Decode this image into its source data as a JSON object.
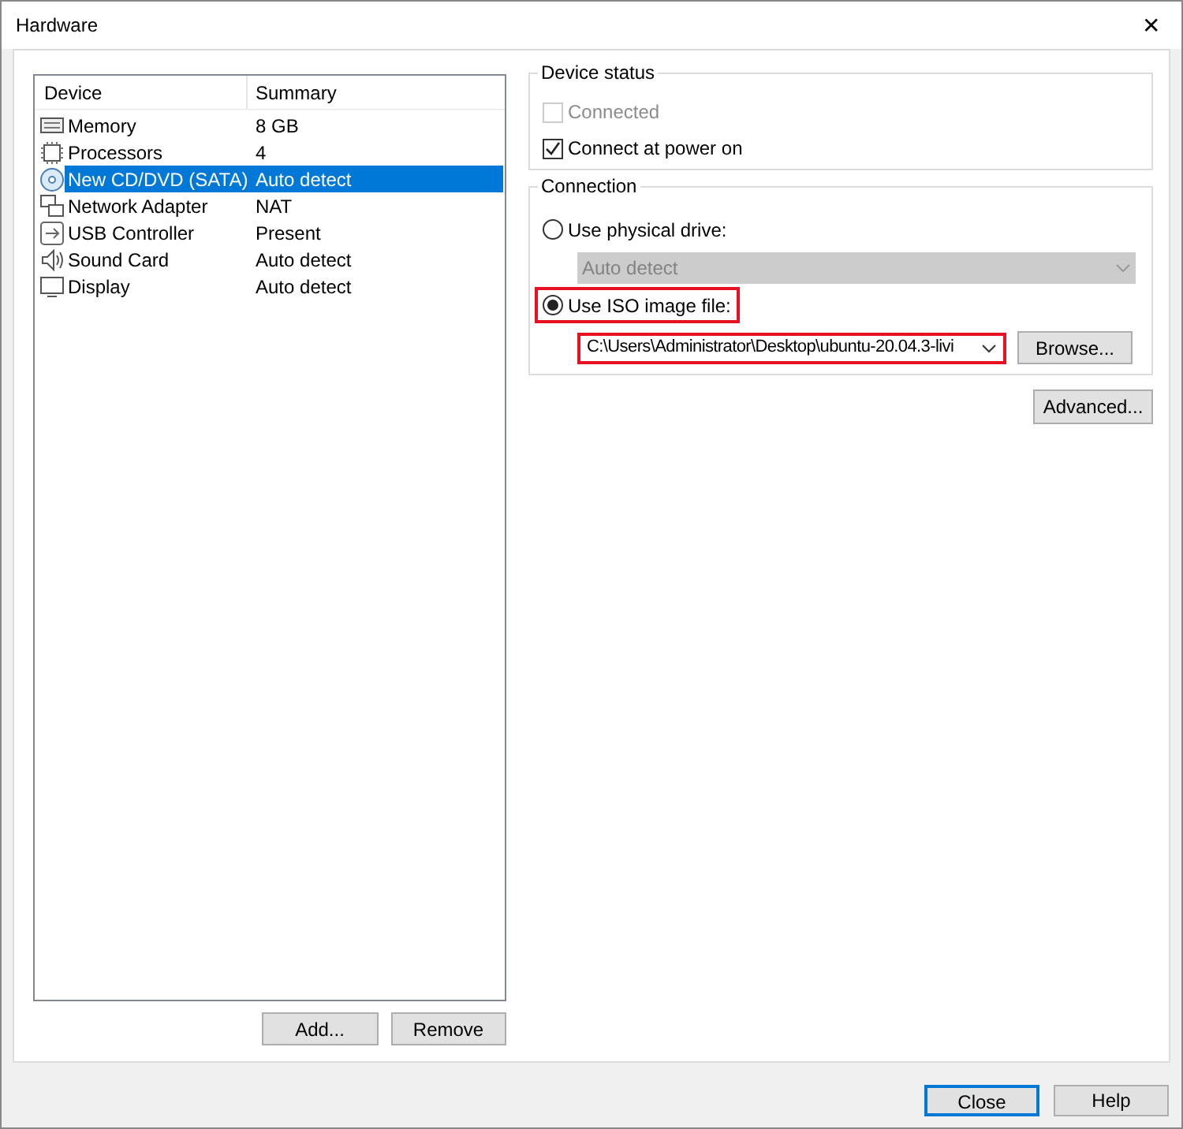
{
  "window": {
    "title": "Hardware",
    "close": "✕"
  },
  "device_list": {
    "columns": [
      "Device",
      "Summary"
    ],
    "rows": [
      {
        "kind": "memory",
        "device": "Memory",
        "summary": "8 GB",
        "selected": false
      },
      {
        "kind": "processor",
        "device": "Processors",
        "summary": "4",
        "selected": false
      },
      {
        "kind": "cd",
        "device": "New CD/DVD (SATA)",
        "summary": "Auto detect",
        "selected": true
      },
      {
        "kind": "network",
        "device": "Network Adapter",
        "summary": "NAT",
        "selected": false
      },
      {
        "kind": "usb",
        "device": "USB Controller",
        "summary": "Present",
        "selected": false
      },
      {
        "kind": "sound",
        "device": "Sound Card",
        "summary": "Auto detect",
        "selected": false
      },
      {
        "kind": "display",
        "device": "Display",
        "summary": "Auto detect",
        "selected": false
      }
    ]
  },
  "list_buttons": [
    "Add...",
    "Remove"
  ],
  "device_status": {
    "title": "Device status",
    "options": [
      {
        "label": "Connected",
        "checked": false,
        "disabled": true
      },
      {
        "label": "Connect at power on",
        "checked": true,
        "disabled": false
      }
    ]
  },
  "connection": {
    "title": "Connection",
    "physical": {
      "label": "Use physical drive:",
      "selected": false,
      "drive": "Auto detect",
      "disabled": true
    },
    "iso": {
      "label": "Use ISO image file:",
      "selected": true,
      "highlighted": true,
      "path": "C:\\Users\\Administrator\\Desktop\\ubuntu-20.04.3-livi",
      "path_highlighted": true
    },
    "browse": "Browse..."
  },
  "advanced": "Advanced...",
  "footer_buttons": [
    {
      "label": "Close",
      "default": true
    },
    {
      "label": "Help",
      "default": false
    }
  ]
}
